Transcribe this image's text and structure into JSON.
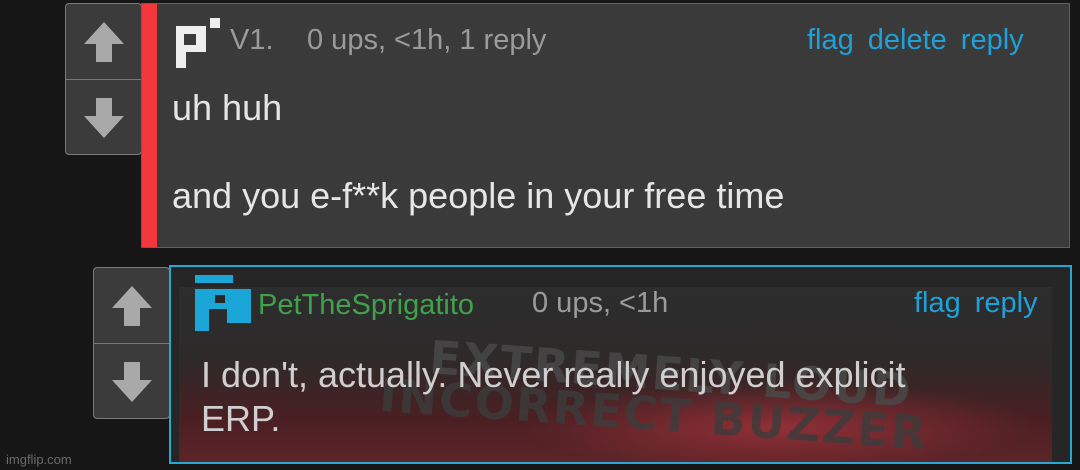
{
  "comments": [
    {
      "username": "V1.",
      "meta": "0 ups, <1h, 1 reply",
      "actions": [
        "flag",
        "delete",
        "reply"
      ],
      "body": "uh huh\n\nand you e-f**k people in your free time",
      "colors": {
        "accent": "#f2383c",
        "username": "#9b9b9b"
      }
    },
    {
      "username": "PetTheSprigatito",
      "meta": "0 ups, <1h",
      "actions": [
        "flag",
        "reply"
      ],
      "body": "I don't, actually. Never really enjoyed explicit\nERP.",
      "background_image_text": [
        "EXTREMELY LOUD",
        "INCORRECT BUZZER"
      ],
      "colors": {
        "border": "#27a7d6",
        "username": "#3fa14a"
      }
    }
  ],
  "votes": {
    "up_icon": "arrow-up-icon",
    "down_icon": "arrow-down-icon"
  },
  "watermark": "imgflip.com"
}
